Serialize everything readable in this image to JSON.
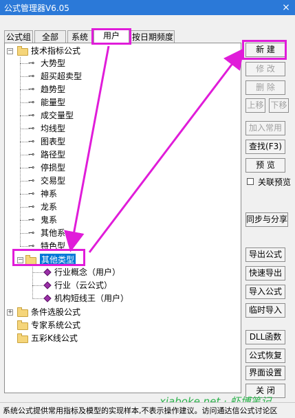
{
  "window": {
    "title": "公式管理器V6.05",
    "close": "×"
  },
  "tabs": [
    "公式组",
    "全部",
    "系统",
    "用户",
    "按日期频度"
  ],
  "tree": {
    "root": "技术指标公式",
    "items": [
      "大势型",
      "超买超卖型",
      "趋势型",
      "能量型",
      "成交量型",
      "均线型",
      "图表型",
      "路径型",
      "停损型",
      "交易型",
      "神系",
      "龙系",
      "鬼系",
      "其他系",
      "特色型"
    ],
    "selected": "其他类型",
    "selected_children": [
      "行业概念（用户）",
      "行业（云公式）",
      "机构短线王（用户）"
    ],
    "other_roots": [
      "条件选股公式",
      "专家系统公式",
      "五彩K线公式"
    ]
  },
  "buttons": {
    "new": "新 建",
    "edit": "修 改",
    "delete": "删 除",
    "up": "上移",
    "down": "下移",
    "add_common": "加入常用",
    "find": "查找(F3)",
    "preview": "预 览",
    "link_preview": "关联预览",
    "sync_share": "同步与分享",
    "export": "导出公式",
    "quick_export": "快速导出",
    "import": "导入公式",
    "temp_import": "临时导入",
    "dll": "DLL函数",
    "restore": "公式恢复",
    "ui_settings": "界面设置",
    "close": "关 闭"
  },
  "status": "系统公式提供常用指标及模型的实现样本,不表示操作建议。访问通达信公式讨论区",
  "watermark": "xiaboke.net · 虾博笔记",
  "colors": {
    "highlight": "#e01cd9",
    "titlebar": "#2b79d8",
    "selection": "#0078d7"
  }
}
